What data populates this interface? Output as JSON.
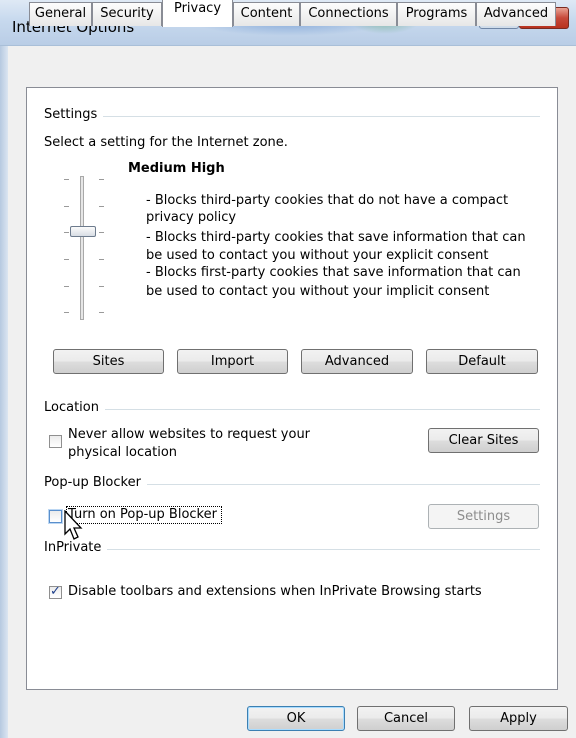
{
  "window": {
    "title": "Internet Options",
    "help_label": "?",
    "close_label": "X"
  },
  "tabs": [
    {
      "label": "General"
    },
    {
      "label": "Security"
    },
    {
      "label": "Privacy",
      "active": true
    },
    {
      "label": "Content"
    },
    {
      "label": "Connections"
    },
    {
      "label": "Programs"
    },
    {
      "label": "Advanced"
    }
  ],
  "settings": {
    "group_label": "Settings",
    "instruction": "Select a setting for the Internet zone.",
    "level_name": "Medium High",
    "slider_level": "Medium High",
    "description_lines": [
      "- Blocks third-party cookies that do not have a compact",
      "privacy policy",
      "- Blocks third-party cookies that save information that can",
      "be used to contact you without your explicit consent",
      "- Blocks first-party cookies that save information that can",
      "be used to contact you without your implicit consent"
    ],
    "buttons": {
      "sites": "Sites",
      "import": "Import",
      "advanced": "Advanced",
      "default": "Default"
    }
  },
  "location": {
    "group_label": "Location",
    "checkbox_label_line1": "Never allow websites to request your",
    "checkbox_label_line2": "physical location",
    "checkbox_checked": false,
    "clear_sites_label": "Clear Sites"
  },
  "popup": {
    "group_label": "Pop-up Blocker",
    "checkbox_label": "Turn on Pop-up Blocker",
    "checkbox_checked": false,
    "settings_label": "Settings",
    "settings_enabled": false
  },
  "inprivate": {
    "group_label": "InPrivate",
    "checkbox_label": "Disable toolbars and extensions when InPrivate Browsing starts",
    "checkbox_checked": true
  },
  "footer": {
    "ok_label": "OK",
    "cancel_label": "Cancel",
    "apply_label": "Apply"
  },
  "colors": {
    "panel_background": "#ffffff",
    "dialog_background": "#f0f0f0",
    "group_line": "#d5dfe5",
    "default_button_border": "#3c7fb1"
  },
  "icons": [
    "help-icon",
    "close-icon",
    "checkmark-icon",
    "mouse-pointer-icon"
  ]
}
